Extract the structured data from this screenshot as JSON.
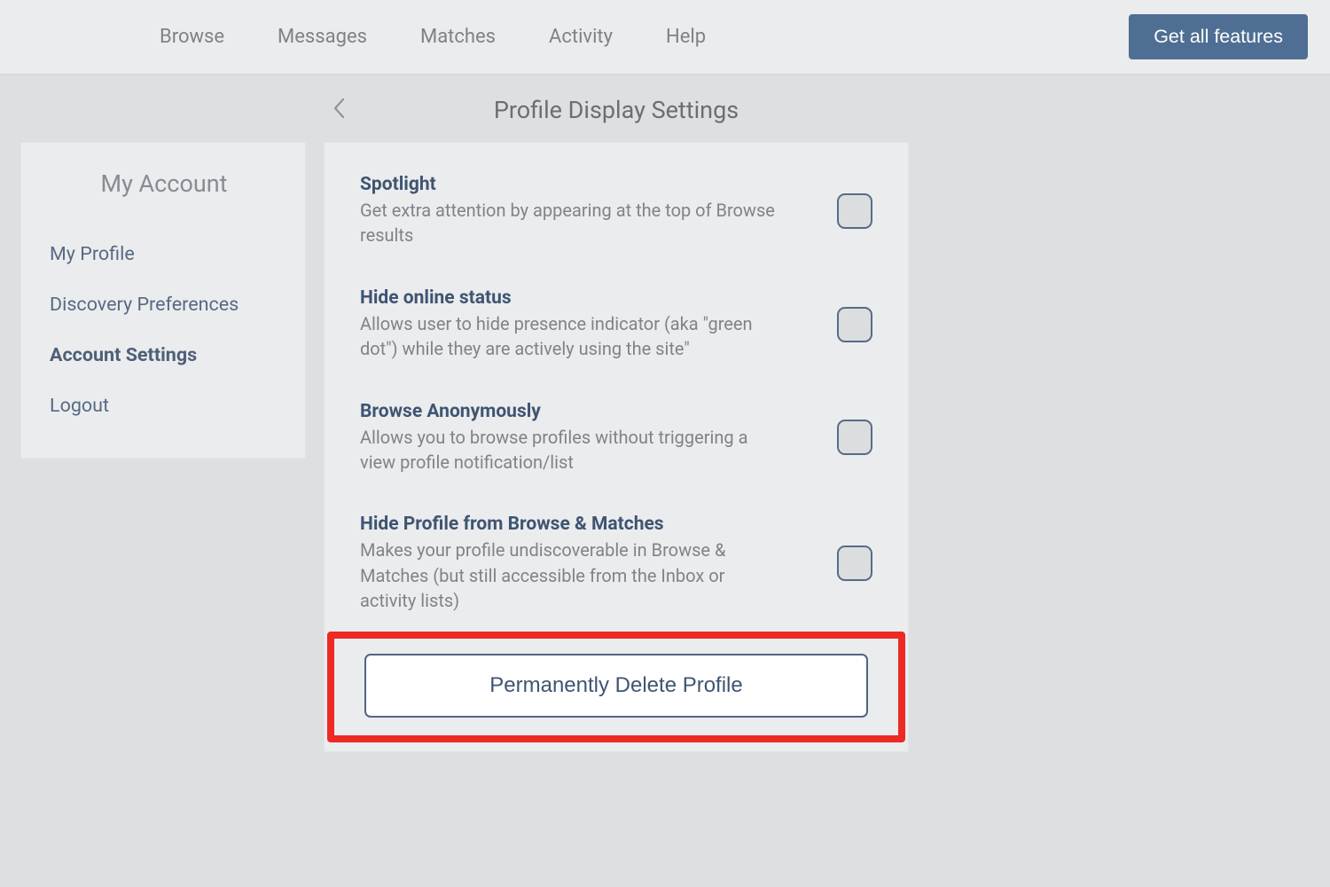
{
  "nav": {
    "items": [
      "Browse",
      "Messages",
      "Matches",
      "Activity",
      "Help"
    ],
    "cta_label": "Get all features"
  },
  "page": {
    "title": "Profile Display Settings"
  },
  "sidebar": {
    "title": "My Account",
    "items": [
      {
        "label": "My Profile",
        "active": false
      },
      {
        "label": "Discovery Preferences",
        "active": false
      },
      {
        "label": "Account Settings",
        "active": true
      },
      {
        "label": "Logout",
        "active": false
      }
    ]
  },
  "settings": [
    {
      "title": "Spotlight",
      "desc": "Get extra attention by appearing at the top of Browse results"
    },
    {
      "title": "Hide online status",
      "desc": "Allows user to hide presence indicator (aka \"green dot\") while they are actively using the site\""
    },
    {
      "title": "Browse Anonymously",
      "desc": "Allows you to browse profiles without triggering a view profile notification/list"
    },
    {
      "title": "Hide Profile from Browse & Matches",
      "desc": "Makes your profile undiscoverable in Browse & Matches (but still accessible from the Inbox or activity lists)"
    }
  ],
  "delete_button_label": "Permanently Delete Profile"
}
